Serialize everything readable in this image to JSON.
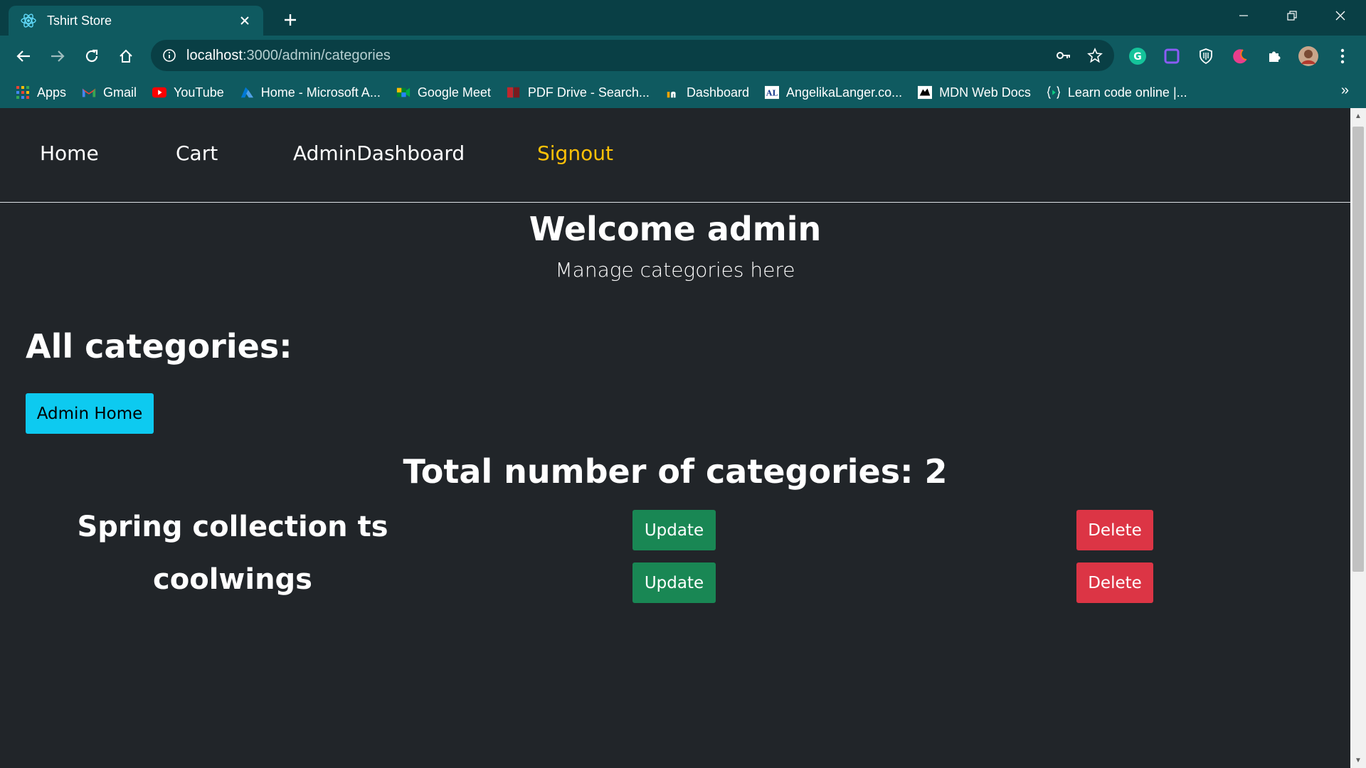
{
  "browser": {
    "tab_title": "Tshirt Store",
    "tab_favicon": "react-icon",
    "url_host": "localhost",
    "url_path": ":3000/admin/categories",
    "bookmarks": [
      {
        "label": "Apps",
        "icon": "apps-grid-icon"
      },
      {
        "label": "Gmail",
        "icon": "gmail-icon"
      },
      {
        "label": "YouTube",
        "icon": "youtube-icon"
      },
      {
        "label": "Home - Microsoft A...",
        "icon": "azure-icon"
      },
      {
        "label": "Google Meet",
        "icon": "google-meet-icon"
      },
      {
        "label": "PDF Drive - Search...",
        "icon": "pdf-drive-icon"
      },
      {
        "label": "Dashboard",
        "icon": "dashboard-icon"
      },
      {
        "label": "AngelikaLanger.co...",
        "icon": "angelikalanger-icon"
      },
      {
        "label": "MDN Web Docs",
        "icon": "mdn-icon"
      },
      {
        "label": "Learn code online |...",
        "icon": "code-brackets-icon"
      }
    ],
    "more_bookmarks": "»",
    "colors": {
      "tabbar": "#093f45",
      "toolbar": "#0f5a60"
    }
  },
  "nav": {
    "home": "Home",
    "cart": "Cart",
    "admin_dashboard": "AdminDashboard",
    "signout": "Signout"
  },
  "page": {
    "title": "Welcome admin",
    "subtitle": "Manage categories here",
    "all_categories_heading": "All categories:",
    "admin_home_button": "Admin Home",
    "total_label": "Total number of categories: 2",
    "categories": [
      {
        "name": "Spring collection ts",
        "update_label": "Update",
        "delete_label": "Delete"
      },
      {
        "name": "coolwings",
        "update_label": "Update",
        "delete_label": "Delete"
      }
    ],
    "colors": {
      "background": "#212529",
      "signout": "#ffc107",
      "info_button": "#0dcaf0",
      "update_button": "#198754",
      "delete_button": "#dc3545"
    }
  }
}
